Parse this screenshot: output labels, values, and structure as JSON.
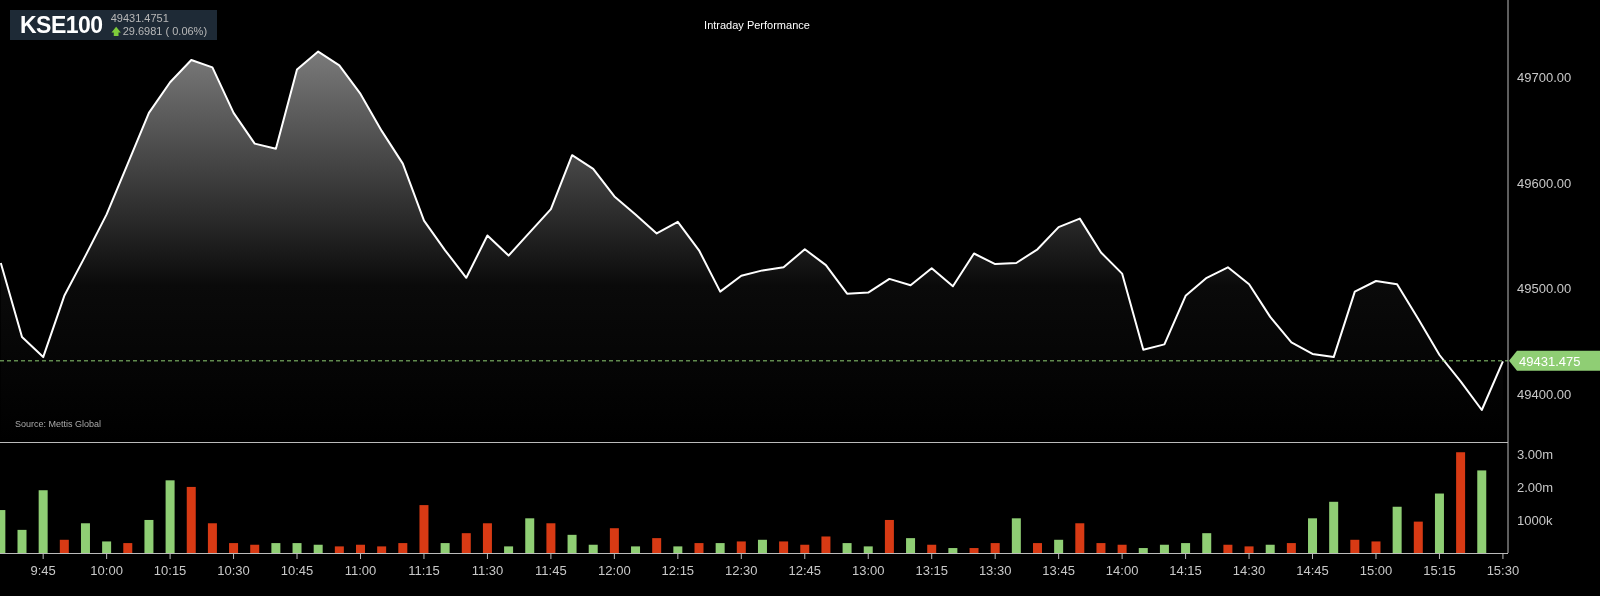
{
  "header": {
    "symbol": "KSE100",
    "price": "49431.4751",
    "arrow": "🡅",
    "change": "29.6981 ( 0.06%)"
  },
  "title": "Intraday Performance",
  "source": "Source: Mettis Global",
  "price_chart": {
    "chart_data": {
      "type": "area",
      "ylim": [
        49354.7,
        49772.8
      ],
      "ref_lines": [
        {
          "axis": "y",
          "value": 49431.475,
          "color": "#8fce74",
          "label": "49431.475"
        }
      ],
      "yticks": [
        {
          "value": 49400,
          "label": "49400.00"
        },
        {
          "value": 49500,
          "label": "49500.00"
        },
        {
          "value": 49600,
          "label": "49600.00"
        },
        {
          "value": 49700,
          "label": "49700.00"
        }
      ],
      "series": [
        {
          "color": "#ffffff",
          "values": [
            49524,
            49454,
            49435,
            49493,
            49531,
            49570,
            49618,
            49666,
            49695,
            49716,
            49709,
            49666,
            49637,
            49632,
            49707,
            49724,
            49711,
            49684,
            49649,
            49618,
            49564,
            49536,
            49510,
            49550,
            49531,
            49553,
            49575,
            49626,
            49613,
            49587,
            49570,
            49552,
            49563,
            49536,
            49497,
            49512,
            49517,
            49520,
            49537,
            49522,
            49495,
            49496,
            49509,
            49503,
            49519,
            49502,
            49533,
            49523,
            49524,
            49537,
            49558,
            49566,
            49534,
            49514,
            49442,
            49447,
            49493,
            49510,
            49520,
            49504,
            49473,
            49449,
            49438,
            49435,
            49497,
            49507,
            49504,
            49471,
            49437,
            49412,
            49385,
            49431
          ]
        }
      ]
    }
  },
  "volume_chart": {
    "chart_data": {
      "type": "bar",
      "ylim": [
        0,
        3360000
      ],
      "categories": [
        null,
        null,
        "9:45",
        null,
        null,
        "10:00",
        null,
        null,
        "10:15",
        null,
        null,
        "10:30",
        null,
        null,
        "10:45",
        null,
        null,
        "11:00",
        null,
        null,
        "11:15",
        null,
        null,
        "11:30",
        null,
        null,
        "11:45",
        null,
        null,
        "12:00",
        null,
        null,
        "12:15",
        null,
        null,
        "12:30",
        null,
        null,
        "12:45",
        null,
        null,
        "13:00",
        null,
        null,
        "13:15",
        null,
        null,
        "13:30",
        null,
        null,
        "13:45",
        null,
        null,
        "14:00",
        null,
        null,
        "14:15",
        null,
        null,
        "14:30",
        null,
        null,
        "14:45",
        null,
        null,
        "15:00",
        null,
        null,
        "15:15",
        null,
        null,
        "15:30"
      ],
      "yticks": [
        {
          "value": 1000000,
          "label": "1000k"
        },
        {
          "value": 2000000,
          "label": "2.00m"
        },
        {
          "value": 3000000,
          "label": "3.00m"
        }
      ],
      "series": [
        {
          "color": "#8fce74",
          "values": [
            1300000,
            700000,
            1900000,
            null,
            900000,
            350000,
            null,
            1000000,
            2200000,
            null,
            null,
            null,
            null,
            300000,
            300000,
            250000,
            null,
            null,
            null,
            null,
            null,
            300000,
            null,
            null,
            200000,
            1050000,
            null,
            550000,
            250000,
            null,
            200000,
            null,
            200000,
            null,
            300000,
            null,
            400000,
            null,
            null,
            null,
            300000,
            200000,
            null,
            450000,
            null,
            150000,
            null,
            null,
            1050000,
            null,
            400000,
            null,
            null,
            null,
            150000,
            250000,
            300000,
            600000,
            null,
            null,
            250000,
            null,
            1050000,
            1550000,
            null,
            null,
            1400000,
            null,
            1800000,
            null,
            2500000,
            null
          ]
        },
        {
          "color": "#d83a14",
          "values": [
            null,
            null,
            null,
            400000,
            null,
            null,
            300000,
            null,
            null,
            2000000,
            900000,
            300000,
            250000,
            null,
            null,
            null,
            200000,
            250000,
            200000,
            300000,
            1450000,
            null,
            600000,
            900000,
            null,
            null,
            900000,
            null,
            null,
            750000,
            null,
            450000,
            null,
            300000,
            null,
            350000,
            null,
            350000,
            250000,
            500000,
            null,
            null,
            1000000,
            null,
            250000,
            null,
            150000,
            300000,
            null,
            300000,
            null,
            900000,
            300000,
            250000,
            null,
            null,
            null,
            null,
            250000,
            200000,
            null,
            300000,
            null,
            null,
            400000,
            350000,
            null,
            950000,
            null,
            3050000,
            null,
            null
          ]
        }
      ]
    }
  }
}
